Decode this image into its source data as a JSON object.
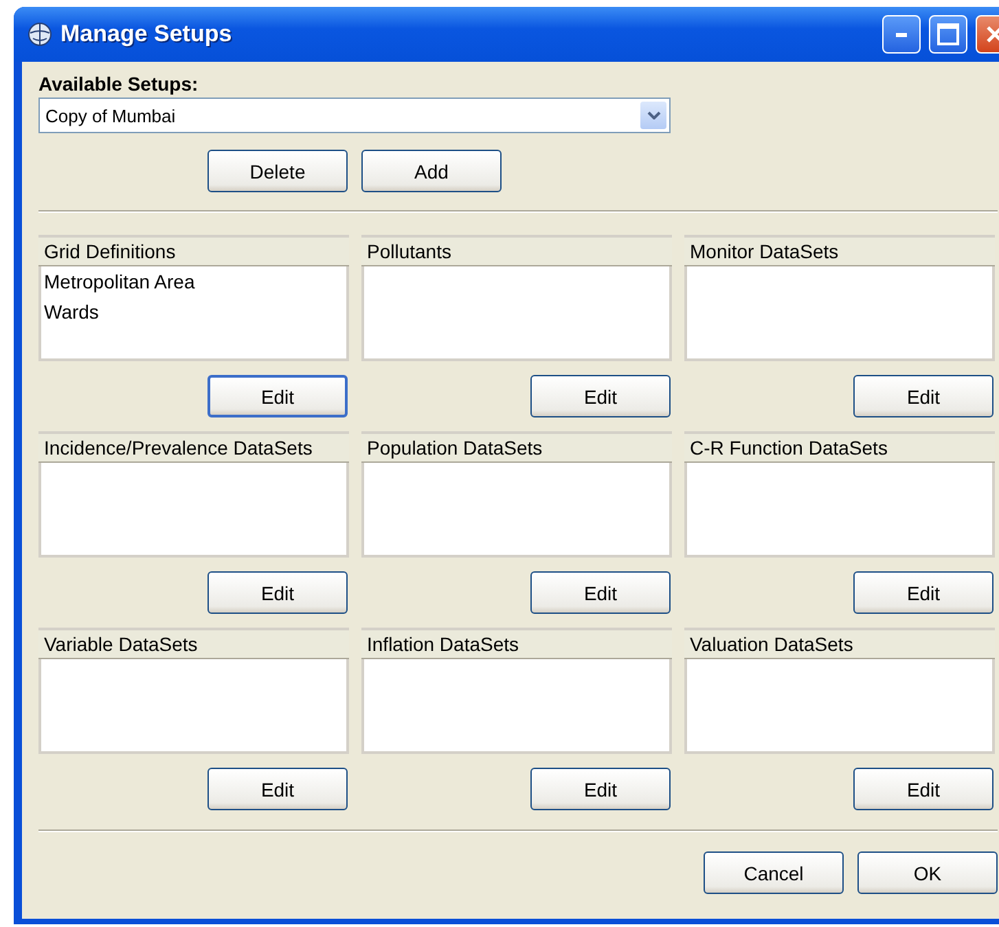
{
  "window": {
    "title": "Manage Setups"
  },
  "available_setups": {
    "label": "Available Setups:",
    "value": "Copy of Mumbai"
  },
  "setup_buttons": [
    "Delete",
    "Add"
  ],
  "panels": [
    {
      "title": "Grid Definitions",
      "items": [
        "Metropolitan Area",
        "Wards"
      ],
      "button": "Edit",
      "focused": true
    },
    {
      "title": "Pollutants",
      "button": "Edit",
      "focused": false
    },
    {
      "title": "Monitor DataSets",
      "button": "Edit",
      "focused": false
    },
    {
      "title": "Incidence/Prevalence DataSets",
      "button": "Edit",
      "focused": false
    },
    {
      "title": "Population DataSets",
      "button": "Edit",
      "focused": false
    },
    {
      "title": "C-R Function DataSets",
      "button": "Edit",
      "focused": false
    },
    {
      "title": "Variable DataSets",
      "button": "Edit",
      "focused": false
    },
    {
      "title": "Inflation DataSets",
      "button": "Edit",
      "focused": false
    },
    {
      "title": "Valuation DataSets",
      "button": "Edit",
      "focused": false
    }
  ],
  "footer_buttons": [
    "Cancel",
    "OK"
  ]
}
